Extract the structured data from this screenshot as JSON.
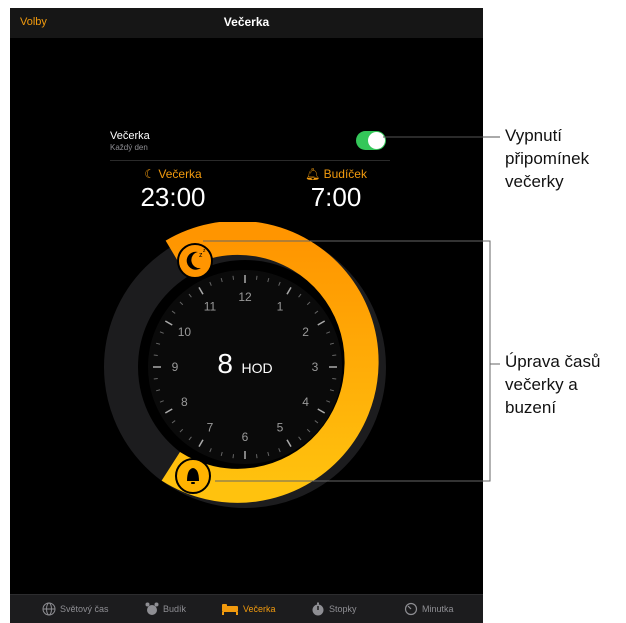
{
  "navbar": {
    "left_label": "Volby",
    "title": "Večerka"
  },
  "reminder_row": {
    "title": "Večerka",
    "subtitle": "Každý den",
    "toggle_on": true
  },
  "bedtime": {
    "label": "Večerka",
    "value": "23:00",
    "icon": "moon-icon"
  },
  "wakeup": {
    "label": "Budíček",
    "value": "7:00",
    "icon": "bell-icon"
  },
  "dial": {
    "hour_numbers": [
      "12",
      "1",
      "2",
      "3",
      "4",
      "5",
      "6",
      "7",
      "8",
      "9",
      "10",
      "11"
    ],
    "duration_value": "8",
    "duration_unit": "HOD",
    "arc_color": "#f5a623"
  },
  "tabs": [
    {
      "label": "Světový čas",
      "icon": "globe-icon",
      "active": false
    },
    {
      "label": "Budík",
      "icon": "alarm-clock-icon",
      "active": false
    },
    {
      "label": "Večerka",
      "icon": "bed-icon",
      "active": true
    },
    {
      "label": "Stopky",
      "icon": "stopwatch-icon",
      "active": false
    },
    {
      "label": "Minutka",
      "icon": "timer-icon",
      "active": false
    }
  ],
  "annotations": {
    "toggle_callout": [
      "Vypnutí",
      "připomínek",
      "večerky"
    ],
    "adjust_callout": [
      "Úprava časů",
      "večerky a",
      "buzení"
    ]
  },
  "colors": {
    "accent": "#f19a0e",
    "toggle_on": "#34c759",
    "background": "#000000"
  }
}
